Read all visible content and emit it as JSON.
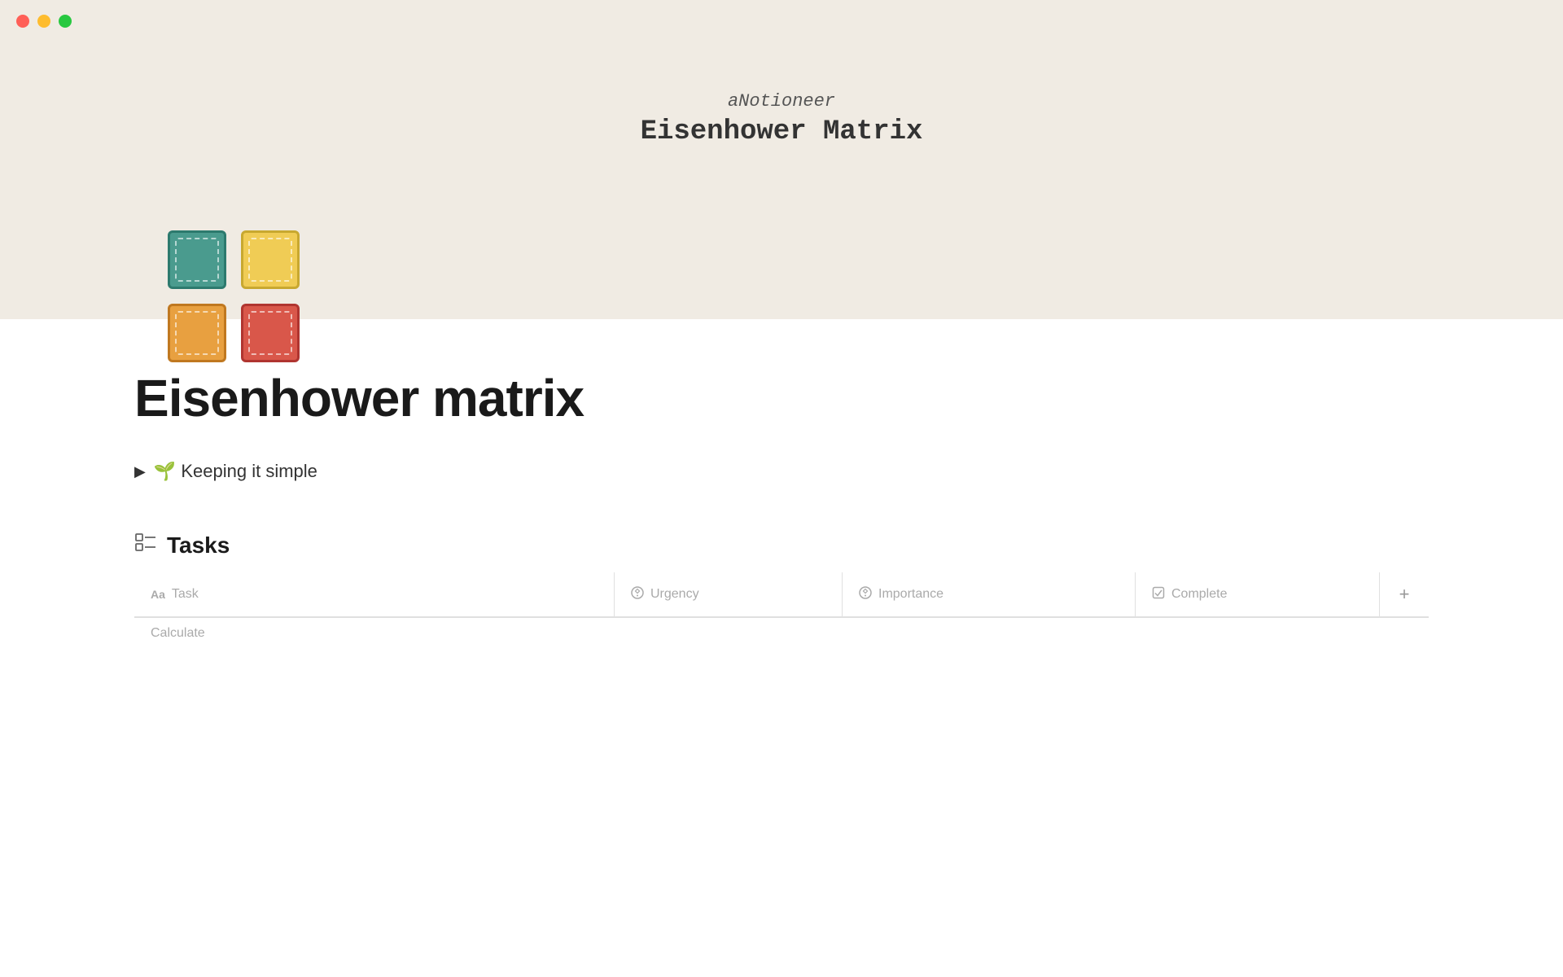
{
  "titlebar": {
    "close_label": "close",
    "minimize_label": "minimize",
    "maximize_label": "maximize"
  },
  "hero": {
    "subtitle": "aNotioneer",
    "title": "Eisenhower Matrix"
  },
  "matrix_cells": [
    {
      "color": "teal",
      "class": "cell-teal"
    },
    {
      "color": "yellow",
      "class": "cell-yellow"
    },
    {
      "color": "orange",
      "class": "cell-orange"
    },
    {
      "color": "red",
      "class": "cell-red"
    }
  ],
  "page": {
    "title": "Eisenhower matrix",
    "toggle_arrow": "▶",
    "toggle_emoji": "🌱",
    "toggle_label": "Keeping it simple"
  },
  "tasks_section": {
    "icon": "≋",
    "title": "Tasks",
    "columns": [
      {
        "id": "task",
        "icon": "Aa",
        "label": "Task"
      },
      {
        "id": "urgency",
        "icon": "⊙",
        "label": "Urgency"
      },
      {
        "id": "importance",
        "icon": "⊙",
        "label": "Importance"
      },
      {
        "id": "complete",
        "icon": "☑",
        "label": "Complete"
      }
    ],
    "add_button_label": "+",
    "bottom_hint": "Calculate"
  }
}
